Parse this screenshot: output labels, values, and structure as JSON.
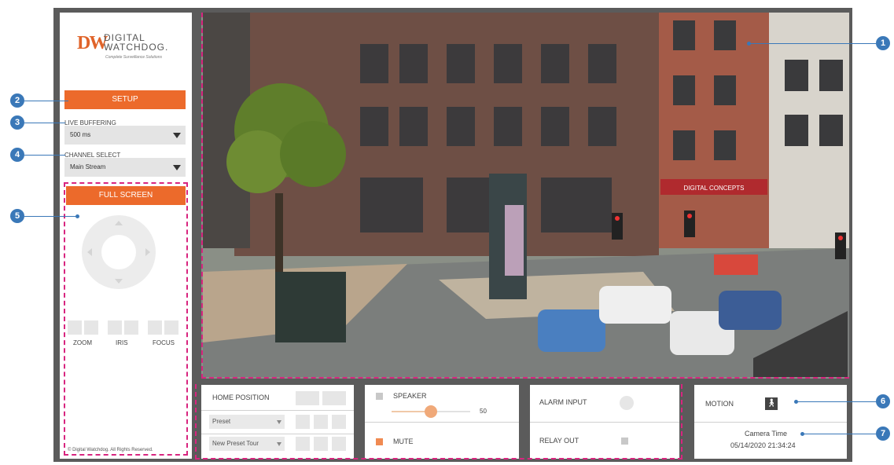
{
  "logo": {
    "mark": "DW",
    "name_line1": "DIGITAL",
    "name_line2": "WATCHDOG.",
    "tagline": "Complete Surveillance Solutions"
  },
  "sidebar": {
    "setup_label": "SETUP",
    "live_buffering_label": "LIVE BUFFERING",
    "live_buffering_value": "500 ms",
    "channel_select_label": "CHANNEL SELECT",
    "channel_select_value": "Main Stream",
    "fullscreen_label": "FULL SCREEN",
    "zoom_label": "ZOOM",
    "iris_label": "IRIS",
    "focus_label": "FOCUS",
    "copyright": "© Digital Watchdog. All Rights Reserved."
  },
  "ptz_panel": {
    "home_position_label": "HOME POSITION",
    "preset_value": "Preset",
    "preset_tour_value": "New Preset Tour"
  },
  "audio_panel": {
    "speaker_label": "SPEAKER",
    "speaker_volume": "50",
    "speaker_volume_level": 0.5,
    "mute_label": "MUTE"
  },
  "io_panel": {
    "alarm_input_label": "ALARM INPUT",
    "relay_out_label": "RELAY OUT"
  },
  "status_panel": {
    "motion_label": "MOTION",
    "camera_time_label": "Camera Time",
    "camera_time_value": "05/14/2020 21:34:24"
  },
  "video": {
    "storefront_sign": "DIGITAL CONCEPTS"
  },
  "callouts": [
    "1",
    "2",
    "3",
    "4",
    "5",
    "6",
    "7"
  ],
  "colors": {
    "accent": "#ec6a2b",
    "dashed_outline": "#d8257f",
    "callout": "#3a78b8",
    "frame": "#5b5b5b"
  }
}
